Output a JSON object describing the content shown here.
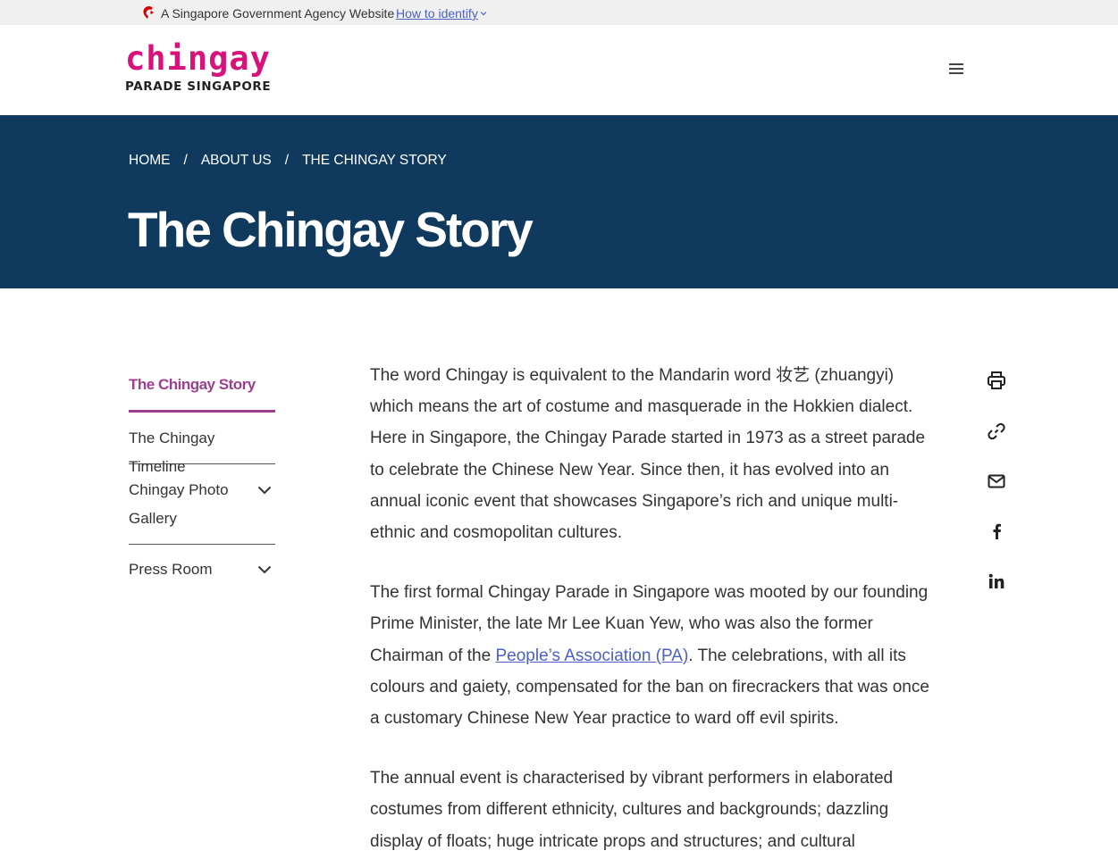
{
  "masthead": {
    "text": "A Singapore Government Agency Website",
    "identify_link": "How to identify"
  },
  "header": {
    "logo_word": "chingay",
    "logo_sub": "PARADE SINGAPORE"
  },
  "breadcrumb": {
    "items": [
      "HOME",
      "ABOUT US",
      "THE CHINGAY STORY"
    ],
    "separator": "/"
  },
  "page": {
    "title": "The Chingay Story"
  },
  "sidenav": {
    "items": [
      {
        "label": "The Chingay Story",
        "active": true
      },
      {
        "label": "The Chingay Timeline"
      },
      {
        "label": "Chingay Photo Gallery",
        "expandable": true
      },
      {
        "label": "Press Room",
        "expandable": true
      }
    ]
  },
  "content": {
    "p1": "The word Chingay is equivalent to the Mandarin word 妆艺 (zhuangyi) which means the art of costume and masquerade in the Hokkien dialect. Here in Singapore, the Chingay Parade started in 1973 as a street parade to celebrate the Chinese New Year. Since then, it has evolved into an annual iconic event that showcases Singapore’s rich and unique multi-ethnic and cosmopolitan cultures.",
    "p2_before": "The first formal Chingay Parade in Singapore was mooted by our founding Prime Minister, the late Mr Lee Kuan Yew, who was also the former Chairman of the ",
    "p2_link": "People’s Association (PA)",
    "p2_after": ". The celebrations, with all its colours and gaiety, compensated for the ban on firecrackers that was once a customary Chinese New Year practice to ward off evil spirits.",
    "p3": "The annual event is characterised by vibrant performers in elaborated costumes from different ethnicity, cultures and backgrounds; dazzling display of floats; huge intricate props and structures; and cultural"
  },
  "share": {
    "icons": [
      "print-icon",
      "link-icon",
      "email-icon",
      "facebook-icon",
      "linkedin-icon"
    ]
  },
  "colors": {
    "masthead_bg": "#f0f0f0",
    "hero_bg": "#0f3a5e",
    "brand_pink": "#d8117b",
    "active_purple": "#9c3f8f",
    "link_blue": "#4b61c4"
  }
}
